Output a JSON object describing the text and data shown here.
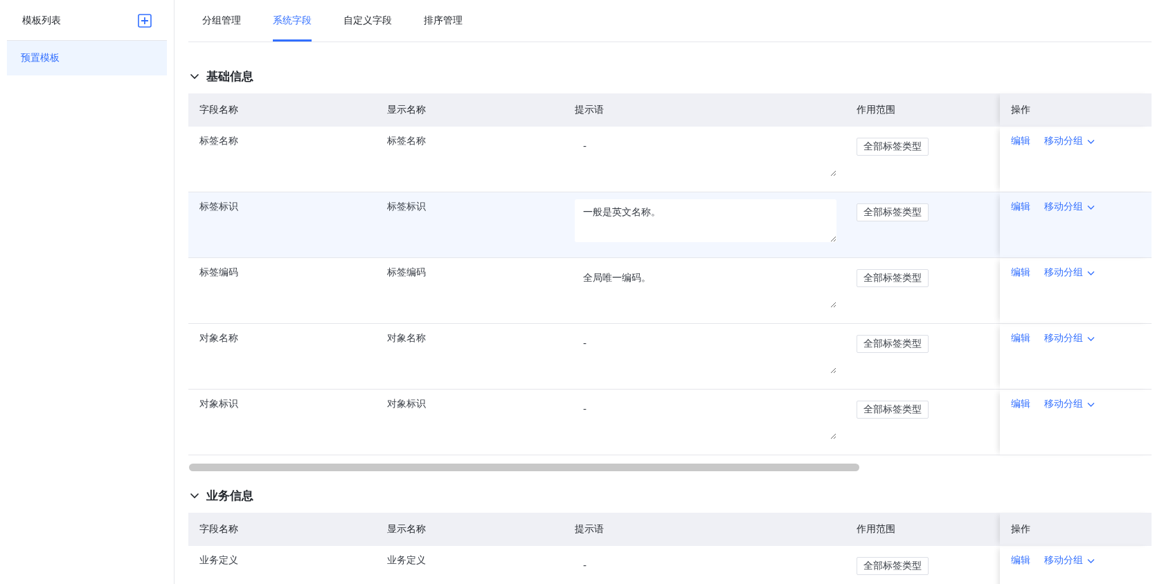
{
  "sidebar": {
    "title": "模板列表",
    "items": [
      {
        "label": "预置模板",
        "selected": true
      }
    ]
  },
  "tabs": [
    {
      "label": "分组管理",
      "selected": false
    },
    {
      "label": "系统字段",
      "selected": true
    },
    {
      "label": "自定义字段",
      "selected": false
    },
    {
      "label": "排序管理",
      "selected": false
    }
  ],
  "sections": [
    {
      "title": "基础信息",
      "expanded": true,
      "columns": [
        "字段名称",
        "显示名称",
        "提示语",
        "作用范围",
        "操作"
      ],
      "rows": [
        {
          "field_name": "标签名称",
          "display_name": "标签名称",
          "hint": {
            "value": "-"
          },
          "scope": "全部标签类型",
          "actions": [
            "编辑",
            "移动分组"
          ],
          "highlighted": false
        },
        {
          "field_name": "标签标识",
          "display_name": "标签标识",
          "hint": {
            "value": "一般是英文名称。"
          },
          "scope": "全部标签类型",
          "actions": [
            "编辑",
            "移动分组"
          ],
          "highlighted": true
        },
        {
          "field_name": "标签编码",
          "display_name": "标签编码",
          "hint": {
            "value": "全局唯一编码。"
          },
          "scope": "全部标签类型",
          "actions": [
            "编辑",
            "移动分组"
          ],
          "highlighted": false
        },
        {
          "field_name": "对象名称",
          "display_name": "对象名称",
          "hint": {
            "value": "-"
          },
          "scope": "全部标签类型",
          "actions": [
            "编辑",
            "移动分组"
          ],
          "highlighted": false
        },
        {
          "field_name": "对象标识",
          "display_name": "对象标识",
          "hint": {
            "value": "-"
          },
          "scope": "全部标签类型",
          "actions": [
            "编辑",
            "移动分组"
          ],
          "highlighted": false
        }
      ]
    },
    {
      "title": "业务信息",
      "expanded": true,
      "columns": [
        "字段名称",
        "显示名称",
        "提示语",
        "作用范围",
        "操作"
      ],
      "rows": [
        {
          "field_name": "业务定义",
          "display_name": "业务定义",
          "hint": {
            "value": "-"
          },
          "scope": "全部标签类型",
          "actions": [
            "编辑",
            "移动分组"
          ],
          "highlighted": false
        }
      ]
    }
  ]
}
